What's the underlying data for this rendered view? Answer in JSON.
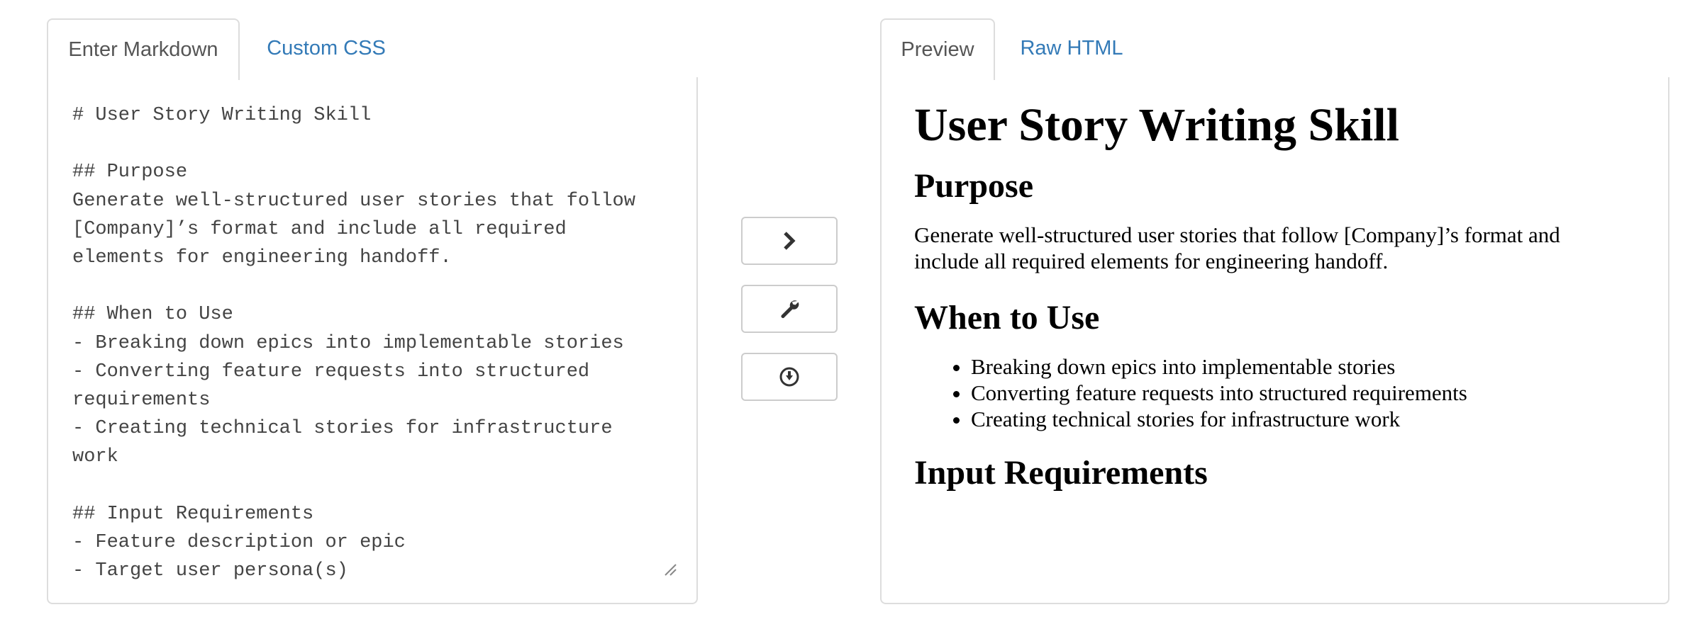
{
  "editor": {
    "tabs": [
      {
        "label": "Enter Markdown",
        "active": true
      },
      {
        "label": "Custom CSS",
        "active": false
      }
    ],
    "content": "# User Story Writing Skill\n\n## Purpose\nGenerate well-structured user stories that follow\n[Company]’s format and include all required\nelements for engineering handoff.\n\n## When to Use\n- Breaking down epics into implementable stories\n- Converting feature requests into structured\nrequirements\n- Creating technical stories for infrastructure\nwork\n\n## Input Requirements\n- Feature description or epic\n- Target user persona(s)"
  },
  "actions": {
    "icons": [
      "chevron-right-icon",
      "wrench-icon",
      "download-circle-icon"
    ]
  },
  "preview": {
    "tabs": [
      {
        "label": "Preview",
        "active": true
      },
      {
        "label": "Raw HTML",
        "active": false
      }
    ],
    "h1": "User Story Writing Skill",
    "sections": [
      {
        "heading": "Purpose",
        "paragraph": "Generate well-structured user stories that follow [Company]’s format and include all required elements for engineering handoff."
      },
      {
        "heading": "When to Use",
        "items": [
          "Breaking down epics into implementable stories",
          "Converting feature requests into structured requirements",
          "Creating technical stories for infrastructure work"
        ]
      },
      {
        "heading": "Input Requirements"
      }
    ]
  },
  "colors": {
    "border": "#dddddd",
    "link": "#337ab7",
    "text": "#333333"
  }
}
